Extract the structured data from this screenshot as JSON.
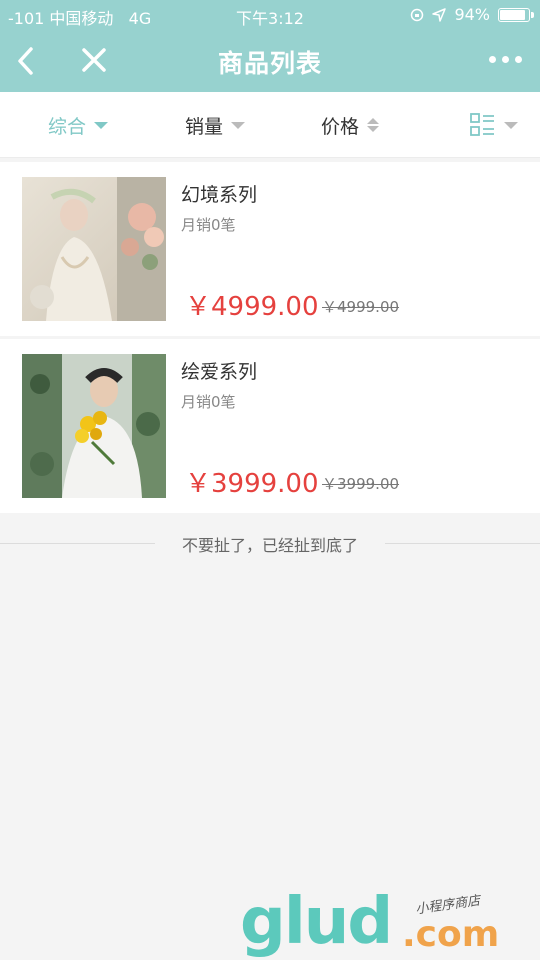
{
  "status": {
    "carrier": "-101 中国移动",
    "network": "4G",
    "time": "下午3:12",
    "battery": "94%",
    "battery_level": 0.94
  },
  "nav": {
    "title": "商品列表",
    "back_icon": "chevron-left-icon",
    "close_icon": "close-icon",
    "more_icon": "more-dots-icon"
  },
  "filters": [
    {
      "label": "综合",
      "active": true
    },
    {
      "label": "销量",
      "active": false
    },
    {
      "label": "价格",
      "active": false
    }
  ],
  "products": [
    {
      "name": "幻境系列",
      "sales": "月销0笔",
      "price": "￥4999.00",
      "original_price": "￥4999.00"
    },
    {
      "name": "绘爱系列",
      "sales": "月销0笔",
      "price": "￥3999.00",
      "original_price": "￥3999.00"
    }
  ],
  "end_text": "不要扯了，已经扯到底了",
  "watermark": {
    "main": "glud",
    "domain": ".com",
    "sub": "小程序商店"
  },
  "colors": {
    "accent": "#97d2cf",
    "active_filter": "#80c8c6",
    "price": "#e5413e"
  }
}
